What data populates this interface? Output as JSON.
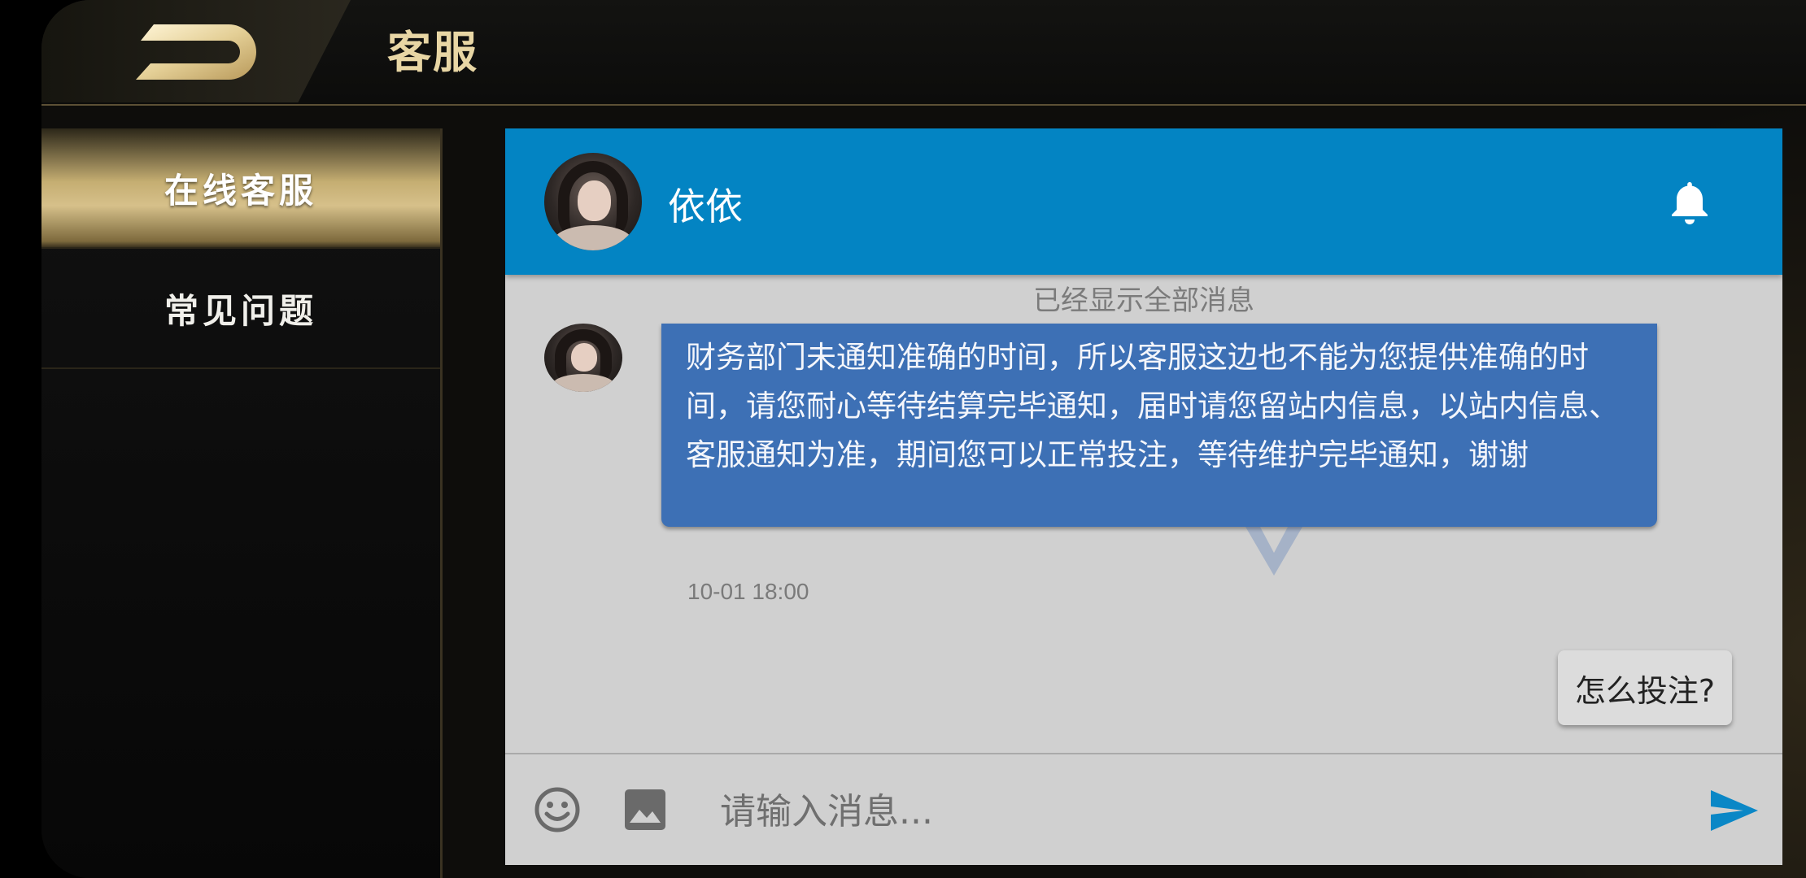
{
  "header": {
    "title": "客服",
    "back_icon": "back-d-icon"
  },
  "sidebar": {
    "items": [
      {
        "label": "在线客服",
        "active": true
      },
      {
        "label": "常见问题",
        "active": false
      }
    ]
  },
  "chat": {
    "agent_name": "依依",
    "notification_icon": "bell-icon",
    "history_notice": "已经显示全部消息",
    "messages": [
      {
        "from": "agent",
        "text": "财务部门未通知准确的时间，所以客服这边也不能为您提供准确的时间，请您耐心等待结算完毕通知，届时请您留站内信息，以站内信息、客服通知为准，期间您可以正常投注，等待维护完毕通知，谢谢",
        "time": "10-01 18:00"
      }
    ],
    "quick_reply": "怎么投注?",
    "input": {
      "placeholder": "请输入消息...",
      "value": ""
    },
    "toolbar_icons": [
      "emoji-icon",
      "image-icon",
      "send-icon"
    ]
  },
  "colors": {
    "header_blue": "#0384C3",
    "bubble_blue": "#3D70B5",
    "gold": "#D6C08A",
    "chat_bg": "#D0D0D0"
  }
}
